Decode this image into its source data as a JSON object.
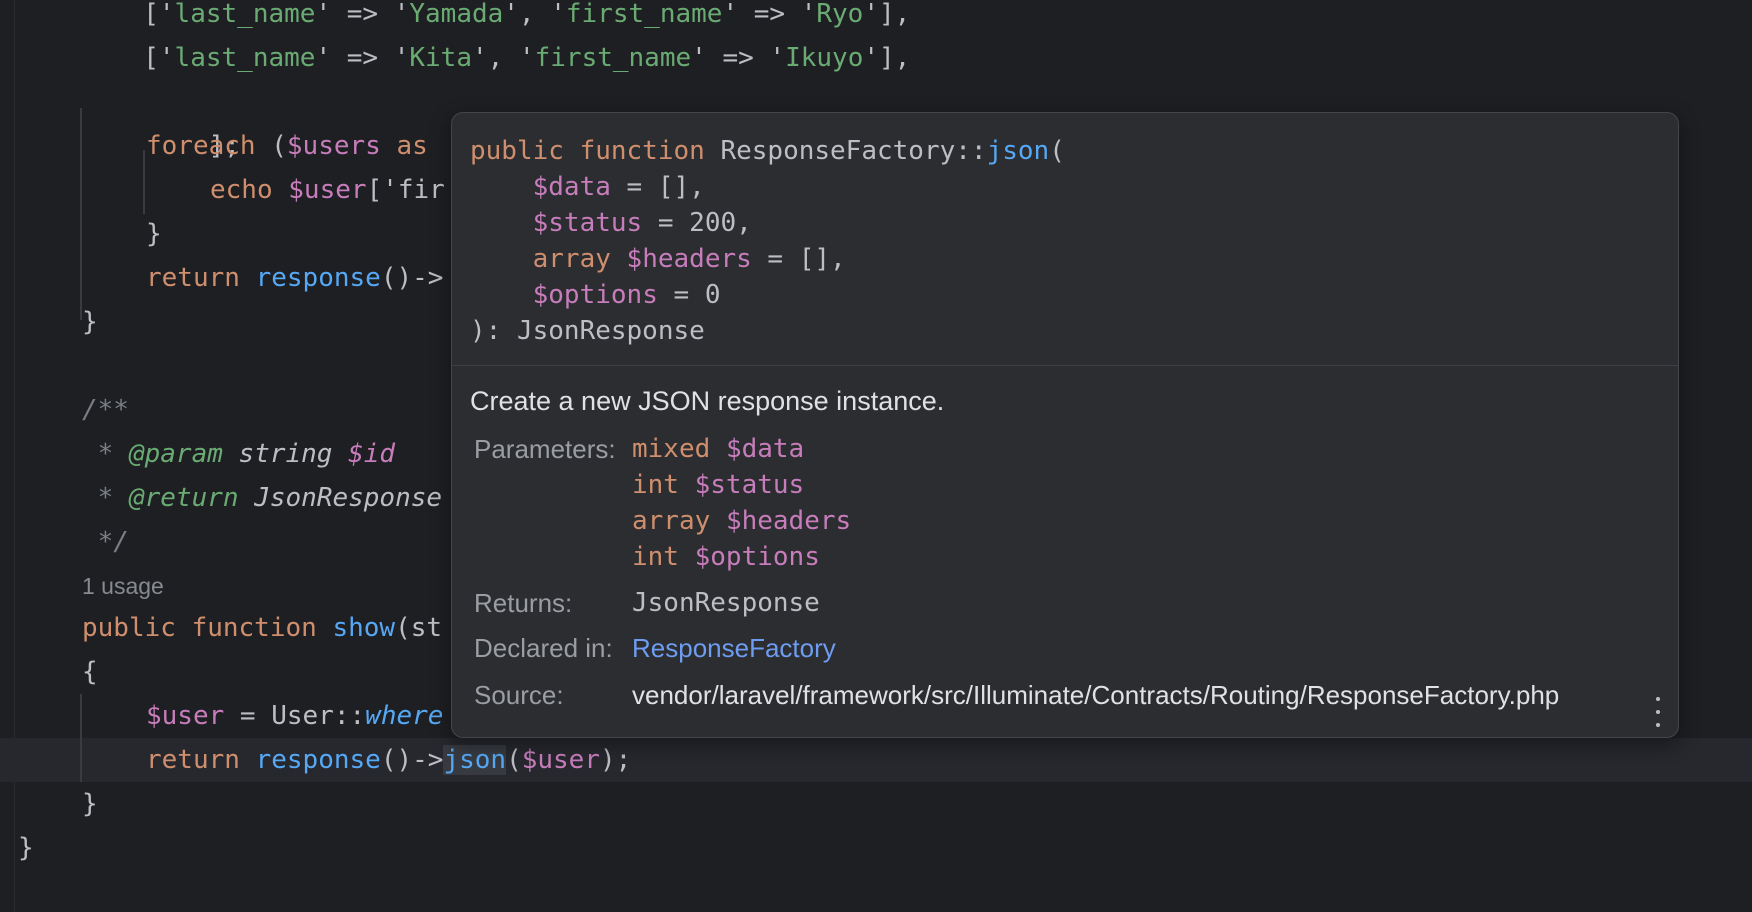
{
  "editor": {
    "lines": [
      {
        "indent": "        ",
        "parts": [
          [
            "",
            "['"
          ],
          [
            "str",
            "last_name"
          ],
          [
            "",
            "' => '"
          ],
          [
            "str",
            "Yamada"
          ],
          [
            "",
            "', '"
          ],
          [
            "str",
            "first_name"
          ],
          [
            "",
            "' => '"
          ],
          [
            "str",
            "Ryo"
          ],
          [
            "",
            "'],"
          ]
        ]
      },
      {
        "indent": "        ",
        "parts": [
          [
            "",
            "['"
          ],
          [
            "str",
            "last_name"
          ],
          [
            "",
            "' => '"
          ],
          [
            "str",
            "Kita"
          ],
          [
            "",
            "', '"
          ],
          [
            "str",
            "first_name"
          ],
          [
            "",
            "' => '"
          ],
          [
            "str",
            "Ikuyo"
          ],
          [
            "",
            "'],"
          ]
        ]
      }
    ],
    "close_bracket": "];",
    "foreach_kw": "foreach",
    "foreach_rest_a": " (",
    "foreach_var": "$users",
    "foreach_as": " as",
    "echo_kw": "echo ",
    "echo_var": "$user",
    "echo_rest": "['fir",
    "close_brace_inner": "}",
    "return_kw": "return ",
    "response_fn": "response",
    "response_rest": "()->",
    "close_brace_method": "}",
    "doc_open": "/**",
    "doc_star": " * ",
    "doc_param_tag": "@param",
    "doc_param_type": " string ",
    "doc_param_var": "$id",
    "doc_return_tag": "@return",
    "doc_return_type": " JsonResponse",
    "doc_close": " */",
    "usage_hint": "1 usage",
    "public_kw": "public function ",
    "show_fn": "show",
    "show_rest": "(st",
    "open_brace": "{",
    "user_var": "$user",
    "assign": " = User::",
    "where_fn": "where",
    "return2_kw": "return ",
    "response2_fn": "response",
    "arrow": "()->",
    "json_fn": "json",
    "paren_open": "(",
    "user_arg": "$user",
    "paren_close": ");",
    "close_brace_method2": "}",
    "close_brace_class": "}"
  },
  "popup": {
    "sig": {
      "public_kw": "public function ",
      "class_name": "ResponseFactory::",
      "method": "json",
      "open": "(",
      "p1_var": "$data",
      "p1_rest": " = [],",
      "p2_var": "$status",
      "p2_rest": " = 200,",
      "p3_type": "array ",
      "p3_var": "$headers",
      "p3_rest": " = [],",
      "p4_var": "$options",
      "p4_rest": " = 0",
      "close": "): JsonResponse"
    },
    "description": "Create a new JSON response instance.",
    "parameters_label": "Parameters:",
    "parameters": [
      {
        "type": "mixed",
        "name": "$data"
      },
      {
        "type": "int",
        "name": "$status"
      },
      {
        "type": "array",
        "name": "$headers"
      },
      {
        "type": "int",
        "name": "$options"
      }
    ],
    "returns_label": "Returns:",
    "returns_value": "JsonResponse",
    "declared_label": "Declared in:",
    "declared_value": "ResponseFactory",
    "source_label": "Source:",
    "source_value": "vendor/laravel/framework/src/Illuminate/Contracts/Routing/ResponseFactory.php",
    "more_icon": "vertical-ellipsis-icon"
  }
}
